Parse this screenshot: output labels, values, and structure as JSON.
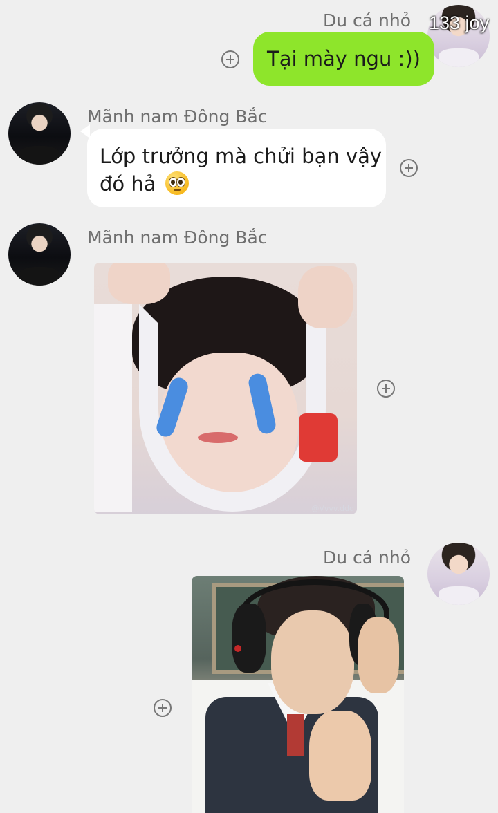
{
  "messages": [
    {
      "sender": "Du cá nhỏ",
      "overlay_label": "133 joy",
      "text": "Tại mày ngu :))",
      "side": "right",
      "kind": "text",
      "bubble_color": "#8ee52b"
    },
    {
      "sender": "Mãnh nam Đông Bắc",
      "text_line1": "Lớp trưởng mà chửi bạn vậy",
      "text_line2": "đó hả",
      "emoji": "pleading-face-icon",
      "side": "left",
      "kind": "text",
      "bubble_color": "#ffffff"
    },
    {
      "sender": "Mãnh nam Đông Bắc",
      "side": "left",
      "kind": "image",
      "image_desc": "crying-sticker",
      "watermark": "@Vvvv.ddd"
    },
    {
      "sender": "Du cá nhỏ",
      "side": "right",
      "kind": "image",
      "image_desc": "headphones-sticker"
    }
  ],
  "icons": {
    "add": "plus-circle-icon"
  },
  "colors": {
    "background": "#efefef",
    "sender_name": "#6f6f6f",
    "green_bubble": "#8ee52b",
    "white_bubble": "#ffffff"
  }
}
